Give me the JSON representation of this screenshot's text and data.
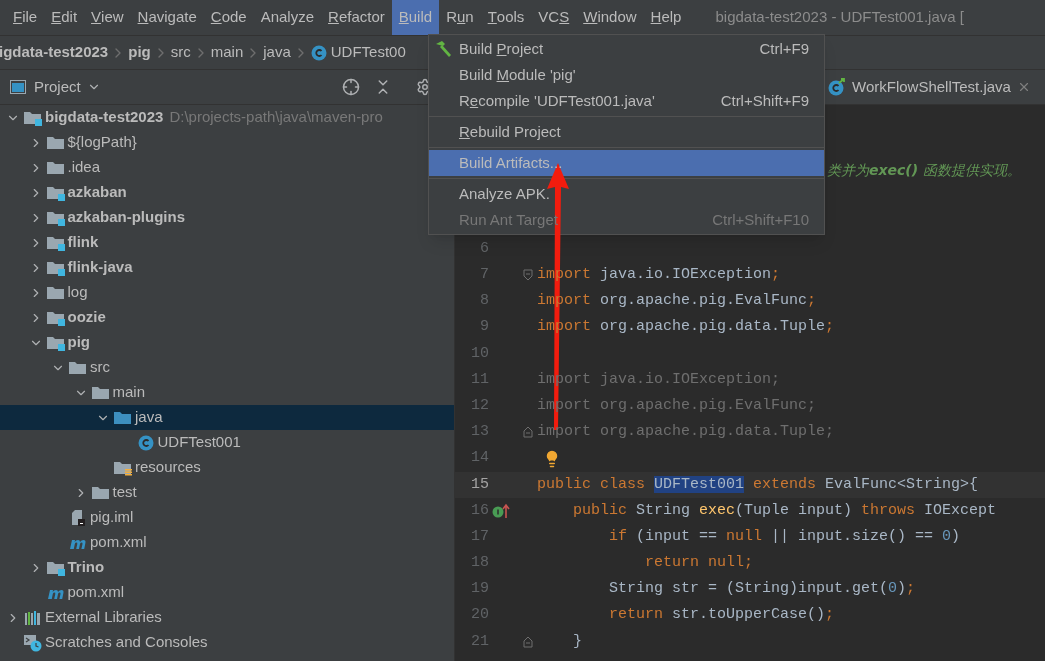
{
  "window": {
    "title": "bigdata-test2023 - UDFTest001.java ["
  },
  "menu_bar": [
    {
      "key": "F",
      "after": "ile",
      "selected": false
    },
    {
      "key": "E",
      "after": "dit",
      "selected": false
    },
    {
      "key": "V",
      "after": "iew",
      "selected": false
    },
    {
      "key": "N",
      "after": "avigate",
      "selected": false
    },
    {
      "key": "C",
      "after": "ode",
      "selected": false
    },
    {
      "before": "Analyze",
      "selected": false
    },
    {
      "key": "R",
      "after": "efactor",
      "selected": false
    },
    {
      "key": "B",
      "after": "uild",
      "selected": true
    },
    {
      "before": "R",
      "key": "u",
      "after": "n",
      "selected": false
    },
    {
      "key": "T",
      "after": "ools",
      "selected": false
    },
    {
      "before": "VC",
      "key": "S",
      "selected": false
    },
    {
      "key": "W",
      "after": "indow",
      "selected": false
    },
    {
      "key": "H",
      "after": "elp",
      "selected": false
    }
  ],
  "breadcrumbs": [
    {
      "label": "igdata-test2023",
      "bold": true
    },
    {
      "label": "pig",
      "bold": true
    },
    {
      "label": "src",
      "bold": false
    },
    {
      "label": "main",
      "bold": false
    },
    {
      "label": "java",
      "bold": false
    },
    {
      "label": "UDFTest00",
      "bold": false,
      "kind": "class"
    }
  ],
  "project_panel": {
    "title": "Project",
    "tree": [
      {
        "kind": "module",
        "label": "bigdata-test2023",
        "path": "D:\\projects-path\\java\\maven-pro",
        "expanded": true,
        "selected": false,
        "children": [
          {
            "kind": "folder",
            "label": "${logPath}",
            "expanded": false,
            "selected": false
          },
          {
            "kind": "folder",
            "label": ".idea",
            "expanded": false,
            "selected": false
          },
          {
            "kind": "module",
            "label": "azkaban",
            "expanded": false,
            "selected": false
          },
          {
            "kind": "module",
            "label": "azkaban-plugins",
            "expanded": false,
            "selected": false
          },
          {
            "kind": "module",
            "label": "flink",
            "expanded": false,
            "selected": false
          },
          {
            "kind": "module",
            "label": "flink-java",
            "expanded": false,
            "selected": false
          },
          {
            "kind": "folder",
            "label": "log",
            "expanded": false,
            "selected": false
          },
          {
            "kind": "module",
            "label": "oozie",
            "expanded": false,
            "selected": false
          },
          {
            "kind": "module",
            "label": "pig",
            "expanded": true,
            "selected": false,
            "children": [
              {
                "kind": "folder",
                "label": "src",
                "expanded": true,
                "selected": false,
                "children": [
                  {
                    "kind": "folder",
                    "label": "main",
                    "expanded": true,
                    "selected": false,
                    "children": [
                      {
                        "kind": "source",
                        "label": "java",
                        "expanded": true,
                        "selected": true,
                        "children": [
                          {
                            "kind": "class",
                            "label": "UDFTest001",
                            "selected": false
                          }
                        ]
                      },
                      {
                        "kind": "resources",
                        "label": "resources",
                        "selected": false
                      }
                    ]
                  },
                  {
                    "kind": "folder",
                    "label": "test",
                    "expanded": false,
                    "selected": false
                  }
                ]
              },
              {
                "kind": "iml",
                "label": "pig.iml",
                "selected": false
              },
              {
                "kind": "maven",
                "label": "pom.xml",
                "selected": false
              }
            ]
          },
          {
            "kind": "module",
            "label": "Trino",
            "expanded": false,
            "selected": false
          },
          {
            "kind": "maven",
            "label": "pom.xml",
            "selected": false
          }
        ]
      },
      {
        "kind": "libraries",
        "label": "External Libraries",
        "expanded": false,
        "selected": false
      },
      {
        "kind": "scratches",
        "label": "Scratches and Consoles",
        "selected": false
      }
    ]
  },
  "editor": {
    "tabs": [
      {
        "label": "WorkFlowShellTest.java",
        "selected": false
      }
    ],
    "comment_fragment": "类并为**exec()** 函数提供实现。",
    "lines": [
      {
        "number": "6",
        "current": false
      },
      {
        "number": "7",
        "current": false,
        "kind": "fold-start",
        "tokens": [
          {
            "text": "import",
            "kind": "keyword"
          },
          {
            "text": " java.io.IOException",
            "kind": "plain"
          },
          {
            "text": ";",
            "kind": "keyword"
          }
        ]
      },
      {
        "number": "8",
        "current": false,
        "tokens": [
          {
            "text": "import",
            "kind": "keyword"
          },
          {
            "text": " org.apache.pig.EvalFunc",
            "kind": "plain"
          },
          {
            "text": ";",
            "kind": "keyword"
          }
        ]
      },
      {
        "number": "9",
        "current": false,
        "tokens": [
          {
            "text": "import",
            "kind": "keyword"
          },
          {
            "text": " org.apache.pig.data.Tuple",
            "kind": "plain"
          },
          {
            "text": ";",
            "kind": "keyword"
          }
        ]
      },
      {
        "number": "10",
        "current": false
      },
      {
        "number": "11",
        "current": false,
        "tokens": [
          {
            "text": "import java.io.IOException;",
            "kind": "unused"
          }
        ]
      },
      {
        "number": "12",
        "current": false,
        "tokens": [
          {
            "text": "import org.apache.pig.EvalFunc;",
            "kind": "unused"
          }
        ]
      },
      {
        "number": "13",
        "current": false,
        "kind": "fold-end",
        "tokens": [
          {
            "text": "import org.apache.pig.data.Tuple;",
            "kind": "unused"
          }
        ]
      },
      {
        "number": "14",
        "current": false,
        "kind": "bulb"
      },
      {
        "number": "15",
        "current": true,
        "tokens": [
          {
            "text": "public class ",
            "kind": "keyword"
          },
          {
            "text": "UDFTest001",
            "kind": "selection"
          },
          {
            "text": " extends ",
            "kind": "keyword"
          },
          {
            "text": "EvalFunc<String>{",
            "kind": "plain"
          }
        ]
      },
      {
        "number": "16",
        "current": false,
        "kind": "override",
        "tokens": [
          {
            "text": "    public ",
            "kind": "keyword"
          },
          {
            "text": "String ",
            "kind": "plain"
          },
          {
            "text": "exec",
            "kind": "method"
          },
          {
            "text": "(Tuple input) ",
            "kind": "plain"
          },
          {
            "text": "throws ",
            "kind": "keyword"
          },
          {
            "text": "IOExcept",
            "kind": "plain"
          }
        ]
      },
      {
        "number": "17",
        "current": false,
        "tokens": [
          {
            "text": "        if ",
            "kind": "keyword"
          },
          {
            "text": "(input == ",
            "kind": "plain"
          },
          {
            "text": "null ",
            "kind": "keyword"
          },
          {
            "text": "|| input.size() == ",
            "kind": "plain"
          },
          {
            "text": "0",
            "kind": "number"
          },
          {
            "text": ")",
            "kind": "plain"
          }
        ]
      },
      {
        "number": "18",
        "current": false,
        "tokens": [
          {
            "text": "            return null;",
            "kind": "keyword"
          }
        ]
      },
      {
        "number": "19",
        "current": false,
        "tokens": [
          {
            "text": "        String str = (String)input.get(",
            "kind": "plain"
          },
          {
            "text": "0",
            "kind": "number"
          },
          {
            "text": ")",
            "kind": "plain"
          },
          {
            "text": ";",
            "kind": "keyword"
          }
        ]
      },
      {
        "number": "20",
        "current": false,
        "tokens": [
          {
            "text": "        return ",
            "kind": "keyword"
          },
          {
            "text": "str.toUpperCase()",
            "kind": "plain"
          },
          {
            "text": ";",
            "kind": "keyword"
          }
        ]
      },
      {
        "number": "21",
        "current": false,
        "kind": "fold-end",
        "tokens": [
          {
            "text": "    }",
            "kind": "plain"
          }
        ]
      }
    ]
  },
  "build_menu": [
    {
      "kind": "item",
      "before": "Build ",
      "key": "P",
      "after": "roject",
      "shortcut": "Ctrl+F9",
      "icon": true,
      "selected": false,
      "disabled": false
    },
    {
      "kind": "item",
      "before": "Build ",
      "key": "M",
      "after": "odule 'pig'",
      "selected": false,
      "disabled": false
    },
    {
      "kind": "item",
      "before": "R",
      "key": "e",
      "after": "compile 'UDFTest001.java'",
      "shortcut": "Ctrl+Shift+F9",
      "selected": false,
      "disabled": false
    },
    {
      "kind": "separator"
    },
    {
      "kind": "item",
      "key": "R",
      "after": "ebuild Project",
      "selected": false,
      "disabled": false
    },
    {
      "kind": "separator"
    },
    {
      "kind": "item",
      "before": "Build Artifacts...",
      "selected": true,
      "disabled": false
    },
    {
      "kind": "separator"
    },
    {
      "kind": "item",
      "before": "Analyze APK.",
      "selected": false,
      "disabled": false
    },
    {
      "kind": "item",
      "before": "Run Ant Target",
      "shortcut": "Ctrl+Shift+F10",
      "selected": false,
      "disabled": true
    }
  ]
}
